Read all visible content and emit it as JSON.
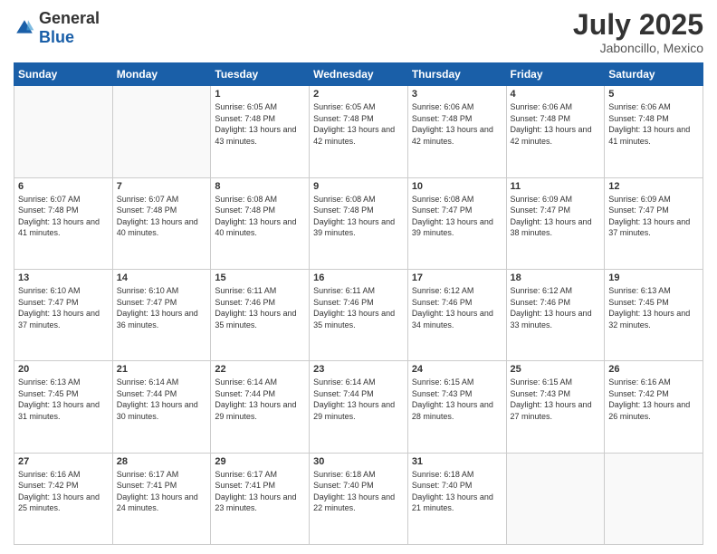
{
  "header": {
    "logo_general": "General",
    "logo_blue": "Blue",
    "title": "July 2025",
    "subtitle": "Jaboncillo, Mexico"
  },
  "calendar": {
    "days_of_week": [
      "Sunday",
      "Monday",
      "Tuesday",
      "Wednesday",
      "Thursday",
      "Friday",
      "Saturday"
    ],
    "weeks": [
      [
        {
          "day": "",
          "info": ""
        },
        {
          "day": "",
          "info": ""
        },
        {
          "day": "1",
          "info": "Sunrise: 6:05 AM\nSunset: 7:48 PM\nDaylight: 13 hours and 43 minutes."
        },
        {
          "day": "2",
          "info": "Sunrise: 6:05 AM\nSunset: 7:48 PM\nDaylight: 13 hours and 42 minutes."
        },
        {
          "day": "3",
          "info": "Sunrise: 6:06 AM\nSunset: 7:48 PM\nDaylight: 13 hours and 42 minutes."
        },
        {
          "day": "4",
          "info": "Sunrise: 6:06 AM\nSunset: 7:48 PM\nDaylight: 13 hours and 42 minutes."
        },
        {
          "day": "5",
          "info": "Sunrise: 6:06 AM\nSunset: 7:48 PM\nDaylight: 13 hours and 41 minutes."
        }
      ],
      [
        {
          "day": "6",
          "info": "Sunrise: 6:07 AM\nSunset: 7:48 PM\nDaylight: 13 hours and 41 minutes."
        },
        {
          "day": "7",
          "info": "Sunrise: 6:07 AM\nSunset: 7:48 PM\nDaylight: 13 hours and 40 minutes."
        },
        {
          "day": "8",
          "info": "Sunrise: 6:08 AM\nSunset: 7:48 PM\nDaylight: 13 hours and 40 minutes."
        },
        {
          "day": "9",
          "info": "Sunrise: 6:08 AM\nSunset: 7:48 PM\nDaylight: 13 hours and 39 minutes."
        },
        {
          "day": "10",
          "info": "Sunrise: 6:08 AM\nSunset: 7:47 PM\nDaylight: 13 hours and 39 minutes."
        },
        {
          "day": "11",
          "info": "Sunrise: 6:09 AM\nSunset: 7:47 PM\nDaylight: 13 hours and 38 minutes."
        },
        {
          "day": "12",
          "info": "Sunrise: 6:09 AM\nSunset: 7:47 PM\nDaylight: 13 hours and 37 minutes."
        }
      ],
      [
        {
          "day": "13",
          "info": "Sunrise: 6:10 AM\nSunset: 7:47 PM\nDaylight: 13 hours and 37 minutes."
        },
        {
          "day": "14",
          "info": "Sunrise: 6:10 AM\nSunset: 7:47 PM\nDaylight: 13 hours and 36 minutes."
        },
        {
          "day": "15",
          "info": "Sunrise: 6:11 AM\nSunset: 7:46 PM\nDaylight: 13 hours and 35 minutes."
        },
        {
          "day": "16",
          "info": "Sunrise: 6:11 AM\nSunset: 7:46 PM\nDaylight: 13 hours and 35 minutes."
        },
        {
          "day": "17",
          "info": "Sunrise: 6:12 AM\nSunset: 7:46 PM\nDaylight: 13 hours and 34 minutes."
        },
        {
          "day": "18",
          "info": "Sunrise: 6:12 AM\nSunset: 7:46 PM\nDaylight: 13 hours and 33 minutes."
        },
        {
          "day": "19",
          "info": "Sunrise: 6:13 AM\nSunset: 7:45 PM\nDaylight: 13 hours and 32 minutes."
        }
      ],
      [
        {
          "day": "20",
          "info": "Sunrise: 6:13 AM\nSunset: 7:45 PM\nDaylight: 13 hours and 31 minutes."
        },
        {
          "day": "21",
          "info": "Sunrise: 6:14 AM\nSunset: 7:44 PM\nDaylight: 13 hours and 30 minutes."
        },
        {
          "day": "22",
          "info": "Sunrise: 6:14 AM\nSunset: 7:44 PM\nDaylight: 13 hours and 29 minutes."
        },
        {
          "day": "23",
          "info": "Sunrise: 6:14 AM\nSunset: 7:44 PM\nDaylight: 13 hours and 29 minutes."
        },
        {
          "day": "24",
          "info": "Sunrise: 6:15 AM\nSunset: 7:43 PM\nDaylight: 13 hours and 28 minutes."
        },
        {
          "day": "25",
          "info": "Sunrise: 6:15 AM\nSunset: 7:43 PM\nDaylight: 13 hours and 27 minutes."
        },
        {
          "day": "26",
          "info": "Sunrise: 6:16 AM\nSunset: 7:42 PM\nDaylight: 13 hours and 26 minutes."
        }
      ],
      [
        {
          "day": "27",
          "info": "Sunrise: 6:16 AM\nSunset: 7:42 PM\nDaylight: 13 hours and 25 minutes."
        },
        {
          "day": "28",
          "info": "Sunrise: 6:17 AM\nSunset: 7:41 PM\nDaylight: 13 hours and 24 minutes."
        },
        {
          "day": "29",
          "info": "Sunrise: 6:17 AM\nSunset: 7:41 PM\nDaylight: 13 hours and 23 minutes."
        },
        {
          "day": "30",
          "info": "Sunrise: 6:18 AM\nSunset: 7:40 PM\nDaylight: 13 hours and 22 minutes."
        },
        {
          "day": "31",
          "info": "Sunrise: 6:18 AM\nSunset: 7:40 PM\nDaylight: 13 hours and 21 minutes."
        },
        {
          "day": "",
          "info": ""
        },
        {
          "day": "",
          "info": ""
        }
      ]
    ]
  }
}
